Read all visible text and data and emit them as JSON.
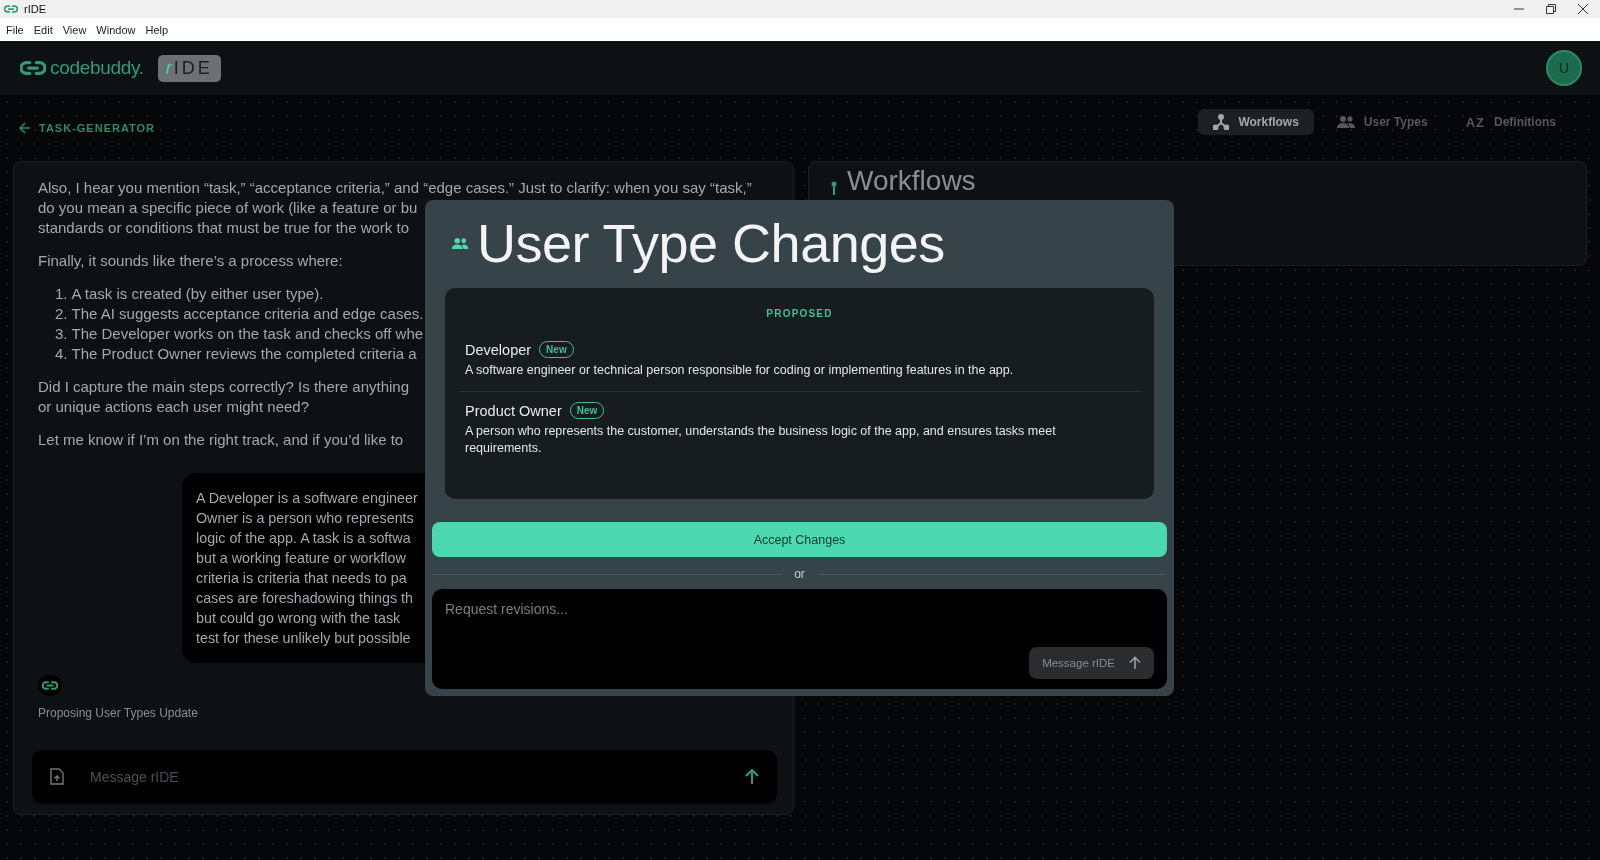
{
  "window": {
    "title": "rIDE"
  },
  "menu": [
    "File",
    "Edit",
    "View",
    "Window",
    "Help"
  ],
  "header": {
    "brand": "codebuddy.",
    "product_mark": "r",
    "product": "IDE",
    "avatar": "U"
  },
  "back_link": "TASK-GENERATOR",
  "tabs": [
    {
      "label": "Workflows",
      "selected": true
    },
    {
      "label": "User Types",
      "selected": false
    },
    {
      "label": "Definitions",
      "icon_label": "AZ",
      "selected": false
    }
  ],
  "chat": {
    "blocks": [
      {
        "kind": "paragraph",
        "lines": [
          "Also, I hear you mention “task,” “acceptance criteria,” and “edge cases.” Just to clarify: when you say “task,”",
          "do you mean a specific piece of work (like a feature or bu",
          "standards or conditions that must be true for the work to"
        ]
      },
      {
        "kind": "paragraph",
        "lines": [
          "Finally, it sounds like there’s a process where:"
        ]
      },
      {
        "kind": "list",
        "items": [
          {
            "number": "1.",
            "text": "A task is created (by either user type)."
          },
          {
            "number": "2.",
            "text": "The AI suggests acceptance criteria and edge cases."
          },
          {
            "number": "3.",
            "text": "The Developer works on the task and checks off whe"
          },
          {
            "number": "4.",
            "text": "The Product Owner reviews the completed criteria a"
          }
        ]
      },
      {
        "kind": "paragraph",
        "lines": [
          "Did I capture the main steps correctly? Is there anything",
          "or unique actions each user might need?"
        ]
      },
      {
        "kind": "paragraph",
        "lines": [
          "Let me know if I’m on the right track, and if you’d like to"
        ]
      },
      {
        "kind": "user_message",
        "lines": [
          "A Developer is a software engineer",
          "Owner is a person who represents",
          "logic of the app. A task is a softwa",
          "but a working feature or workflow",
          "criteria is criteria that needs to pa",
          "cases are foreshadowing things th",
          "but could go wrong with the task",
          "test for these unlikely but possible"
        ]
      },
      {
        "kind": "status",
        "text": "Proposing User Types Update"
      }
    ],
    "composer": {
      "placeholder": "Message rIDE"
    }
  },
  "workflows_panel": {
    "title": "Workflows"
  },
  "modal": {
    "title": "User Type Changes",
    "section": "PROPOSED",
    "items": [
      {
        "name": "Developer",
        "badge": "New",
        "description": "A software engineer or technical person responsible for coding or implementing features in the app."
      },
      {
        "name": "Product Owner",
        "badge": "New",
        "description": "A person who represents the customer, understands the business logic of the app, and ensures tasks meet requirements."
      }
    ],
    "accept": "Accept Changes",
    "separator": "or",
    "revision": {
      "placeholder": "Request revisions...",
      "send": "Message rIDE",
      "send_disabled": true
    }
  }
}
